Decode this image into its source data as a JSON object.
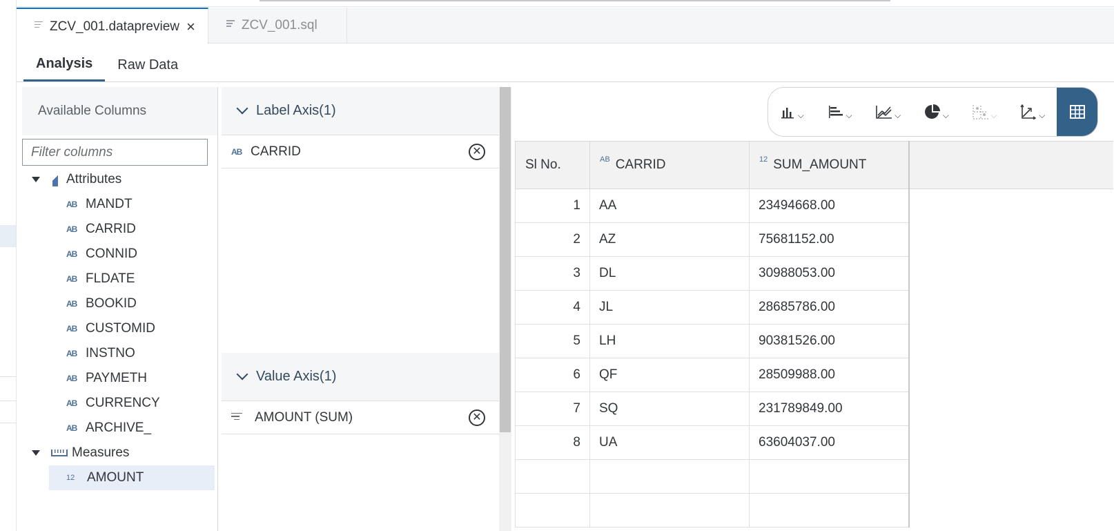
{
  "editor_tabs": [
    {
      "label": "ZCV_001.datapreview",
      "active": true,
      "closable": true
    },
    {
      "label": "ZCV_001.sql",
      "active": false,
      "closable": false
    }
  ],
  "view_tabs": [
    {
      "label": "Analysis",
      "active": true
    },
    {
      "label": "Raw Data",
      "active": false
    }
  ],
  "columns_panel": {
    "title": "Available Columns",
    "filter_placeholder": "Filter columns",
    "attributes_label": "Attributes",
    "attributes": [
      "MANDT",
      "CARRID",
      "CONNID",
      "FLDATE",
      "BOOKID",
      "CUSTOMID",
      "INSTNO",
      "PAYMETH",
      "CURRENCY",
      "ARCHIVE_"
    ],
    "measures_label": "Measures",
    "measures": [
      "AMOUNT"
    ],
    "type_icon_attr": "AB",
    "type_icon_num": "12"
  },
  "axis_panel": {
    "label_axis_title": "Label Axis(1)",
    "label_axis_items": [
      "CARRID"
    ],
    "value_axis_title": "Value Axis(1)",
    "value_axis_items": [
      "AMOUNT (SUM)"
    ]
  },
  "toolbar": {
    "buttons": [
      "bar-chart-icon",
      "horizontal-bar-chart-icon",
      "line-chart-icon",
      "pie-chart-icon",
      "scatter-chart-icon",
      "axis-chart-icon",
      "table-view-icon"
    ],
    "accent": "#346187"
  },
  "table": {
    "headers": [
      "Sl No.",
      "CARRID",
      "SUM_AMOUNT"
    ],
    "rows": [
      [
        "1",
        "AA",
        "23494668.00"
      ],
      [
        "2",
        "AZ",
        "75681152.00"
      ],
      [
        "3",
        "DL",
        "30988053.00"
      ],
      [
        "4",
        "JL",
        "28685786.00"
      ],
      [
        "5",
        "LH",
        "90381526.00"
      ],
      [
        "6",
        "QF",
        "28509988.00"
      ],
      [
        "7",
        "SQ",
        "231789849.00"
      ],
      [
        "8",
        "UA",
        "63604037.00"
      ]
    ]
  }
}
